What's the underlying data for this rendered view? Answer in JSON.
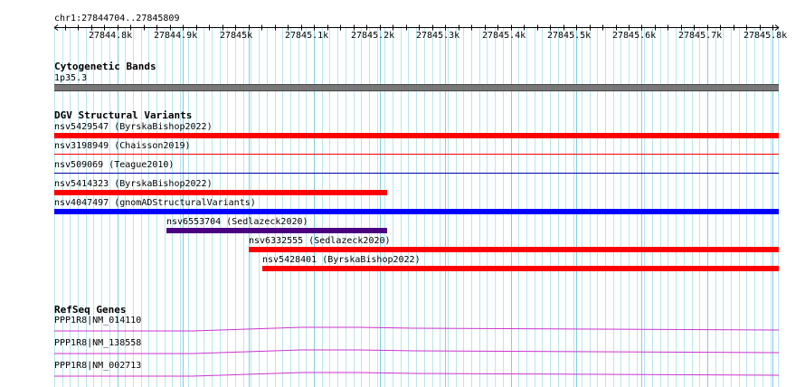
{
  "locus": "chr1:27844704..27845809",
  "ruler": {
    "start": 27844704,
    "end": 27845809,
    "ticks": [
      {
        "pos": 27844800,
        "label": "27844.8k"
      },
      {
        "pos": 27844900,
        "label": "27844.9k"
      },
      {
        "pos": 27845000,
        "label": "27845k"
      },
      {
        "pos": 27845100,
        "label": "27845.1k"
      },
      {
        "pos": 27845200,
        "label": "27845.2k"
      },
      {
        "pos": 27845300,
        "label": "27845.3k"
      },
      {
        "pos": 27845400,
        "label": "27845.4k"
      },
      {
        "pos": 27845500,
        "label": "27845.5k"
      },
      {
        "pos": 27845600,
        "label": "27845.6k"
      },
      {
        "pos": 27845700,
        "label": "27845.7k"
      },
      {
        "pos": 27845800,
        "label": "27845.8k"
      }
    ]
  },
  "tracks": {
    "cytobands": {
      "title": "Cytogenetic Bands",
      "band": {
        "name": "1p35.3",
        "color": "#777777"
      }
    },
    "dgv": {
      "title": "DGV Structural Variants",
      "features": [
        {
          "name": "nsv5429547 (ByrskaBishop2022)",
          "start": 27844704,
          "end": 27845809,
          "color": "#ff0000",
          "style": "thick"
        },
        {
          "name": "nsv3198949 (Chaisson2019)",
          "start": 27844704,
          "end": 27845809,
          "color": "#ff0000",
          "style": "thin"
        },
        {
          "name": "nsv509069 (Teague2010)",
          "start": 27844704,
          "end": 27845809,
          "color": "#0000aa",
          "style": "thin"
        },
        {
          "name": "nsv5414323 (ByrskaBishop2022)",
          "start": 27844704,
          "end": 27845211,
          "color": "#ff0000",
          "style": "thick"
        },
        {
          "name": "nsv4047497 (gnomADStructuralVariants)",
          "start": 27844704,
          "end": 27845809,
          "color": "#0000ff",
          "style": "thick"
        },
        {
          "name": "nsv6553704 (Sedlazeck2020)",
          "start": 27844875,
          "end": 27845211,
          "color": "#4b0082",
          "style": "thick"
        },
        {
          "name": "nsv6332555 (Sedlazeck2020)",
          "start": 27845001,
          "end": 27845809,
          "color": "#ff0000",
          "style": "thick"
        },
        {
          "name": "nsv5428401 (ByrskaBishop2022)",
          "start": 27845021,
          "end": 27845809,
          "color": "#ff0000",
          "style": "thick"
        }
      ]
    },
    "refseq": {
      "title": "RefSeq Genes",
      "features": [
        {
          "name": "PPP1R8|NM_014110",
          "color": "#cc33cc"
        },
        {
          "name": "PPP1R8|NM_138558",
          "color": "#cc33cc"
        },
        {
          "name": "PPP1R8|NM_002713",
          "color": "#cc33cc"
        }
      ]
    }
  }
}
